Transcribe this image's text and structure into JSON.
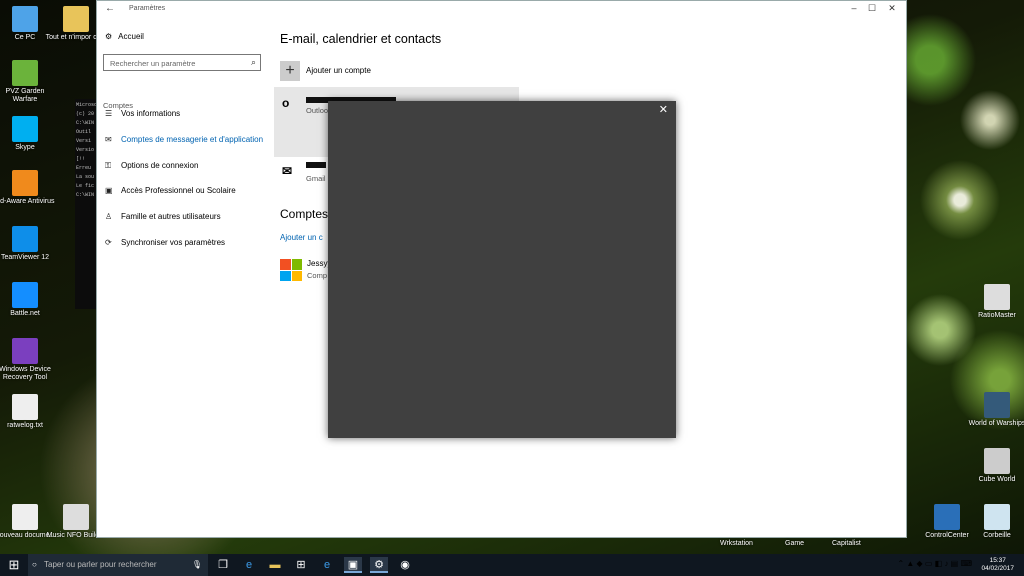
{
  "desktop": {
    "left_icons": [
      {
        "label": "Ce PC",
        "icon": "computer-icon",
        "color": "#4ea3e8"
      },
      {
        "label": "PVZ Garden Warfare",
        "icon": "game-icon",
        "color": "#6bb33b"
      },
      {
        "label": "Skype",
        "icon": "skype-icon",
        "color": "#00aff0"
      },
      {
        "label": "Ad-Aware Antivirus",
        "icon": "antivirus-icon",
        "color": "#f08a1c"
      },
      {
        "label": "TeamViewer 12",
        "icon": "teamviewer-icon",
        "color": "#0e8ee9"
      },
      {
        "label": "Battle.net",
        "icon": "battlenet-icon",
        "color": "#148eff"
      },
      {
        "label": "Windows Device Recovery Tool",
        "icon": "recovery-tool-icon",
        "color": "#7b3fbf"
      },
      {
        "label": "ratwelog.txt",
        "icon": "text-file-icon",
        "color": "#eeeeee"
      },
      {
        "label": "Nouveau docume...",
        "icon": "document-icon",
        "color": "#eeeeee"
      }
    ],
    "second_col_icons": [
      {
        "label": "Tout et n'impor quoi",
        "icon": "folder-icon",
        "color": "#e8c45a"
      },
      {
        "label": "Music NFO Builder",
        "icon": "nfo-builder-icon",
        "color": "#dddddd"
      }
    ],
    "right_icons": [
      {
        "label": "RatioMaster",
        "icon": "ratiomaster-icon",
        "color": "#dddddd"
      },
      {
        "label": "World of Warships",
        "icon": "warships-icon",
        "color": "#345a7a"
      },
      {
        "label": "Cube World",
        "icon": "cubeworld-icon",
        "color": "#cccccc"
      },
      {
        "label": "ControlCenter",
        "icon": "controlcenter-icon",
        "color": "#2a6fb8"
      },
      {
        "label": "Corbeille",
        "icon": "recycle-bin-icon",
        "color": "#cfe4f0"
      }
    ],
    "bottom_labels": [
      "Wrkstation",
      "Game",
      "Capitalist"
    ]
  },
  "window": {
    "title": "Paramètres",
    "sidebar": {
      "home": "Accueil",
      "search_placeholder": "Rechercher un paramètre",
      "section": "Comptes",
      "items": [
        {
          "label": "Vos informations",
          "icon": "person-card-icon"
        },
        {
          "label": "Comptes de messagerie et d'application",
          "icon": "mail-icon",
          "active": true
        },
        {
          "label": "Options de connexion",
          "icon": "key-icon"
        },
        {
          "label": "Accès Professionnel ou Scolaire",
          "icon": "briefcase-icon"
        },
        {
          "label": "Famille et autres utilisateurs",
          "icon": "family-icon"
        },
        {
          "label": "Synchroniser vos paramètres",
          "icon": "sync-icon"
        }
      ]
    },
    "content": {
      "title": "E-mail, calendrier et contacts",
      "add_account": "Ajouter un compte",
      "accounts": [
        {
          "type": "Outlook",
          "icon": "outlook-icon"
        },
        {
          "type": "Gmail",
          "icon": "envelope-icon"
        }
      ],
      "section_title": "Comptes",
      "section_link": "Ajouter un c",
      "ms_account": {
        "name": "Jessyy",
        "type": "Comp"
      }
    }
  },
  "taskbar": {
    "search_placeholder": "Taper ou parler pour rechercher",
    "time": "15:37",
    "date": "04/02/2017"
  }
}
